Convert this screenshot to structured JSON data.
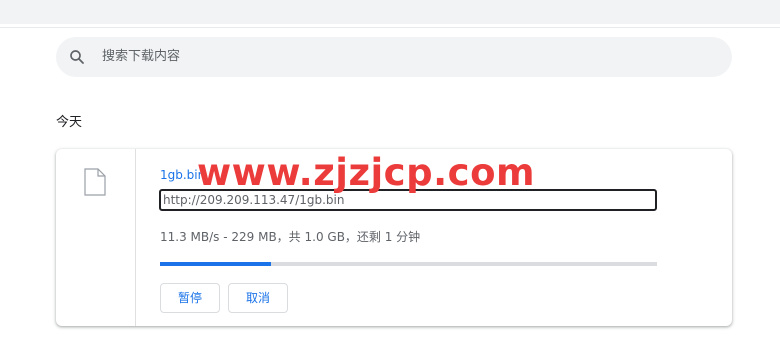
{
  "search": {
    "placeholder": "搜索下载内容"
  },
  "section": {
    "title": "今天"
  },
  "download": {
    "file_name": "1gb.bin",
    "url": "http://209.209.113.47/1gb.bin",
    "status": "11.3 MB/s - 229 MB，共 1.0 GB，还剩 1 分钟",
    "progress_fraction": 0.224,
    "pause_label": "暂停",
    "cancel_label": "取消",
    "file_icon": "file-icon"
  },
  "watermark": {
    "text": "www.zjzjcp.com"
  },
  "colors": {
    "accent": "#1a73e8",
    "watermark": "#ec3b3b"
  }
}
